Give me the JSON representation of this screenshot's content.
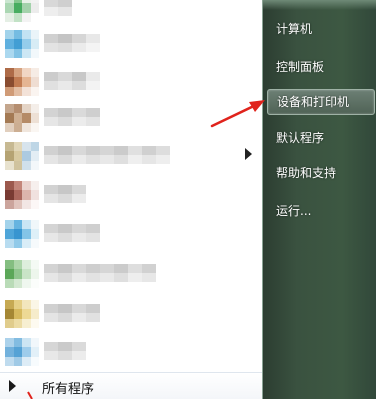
{
  "start_menu": {
    "right_pane": {
      "items": [
        {
          "label": "计算机"
        },
        {
          "label": "控制面板"
        },
        {
          "label": "设备和打印机"
        },
        {
          "label": "默认程序"
        },
        {
          "label": "帮助和支持"
        },
        {
          "label": "运行..."
        }
      ],
      "highlighted_index": 2
    },
    "left_pane": {
      "all_programs_label": "所有程序"
    }
  }
}
